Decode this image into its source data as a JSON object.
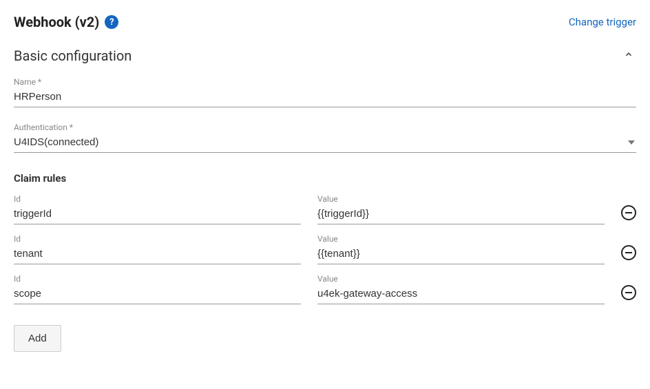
{
  "header": {
    "title": "Webhook (v2)",
    "change_trigger": "Change trigger"
  },
  "section": {
    "title": "Basic configuration"
  },
  "fields": {
    "name_label": "Name *",
    "name_value": "HRPerson",
    "auth_label": "Authentication *",
    "auth_value": "U4IDS(connected)"
  },
  "claim_rules": {
    "title": "Claim rules",
    "id_label": "Id",
    "value_label": "Value",
    "rows": [
      {
        "id": "triggerId",
        "value": "{{triggerId}}"
      },
      {
        "id": "tenant",
        "value": "{{tenant}}"
      },
      {
        "id": "scope",
        "value": "u4ek-gateway-access"
      }
    ],
    "add_label": "Add"
  }
}
